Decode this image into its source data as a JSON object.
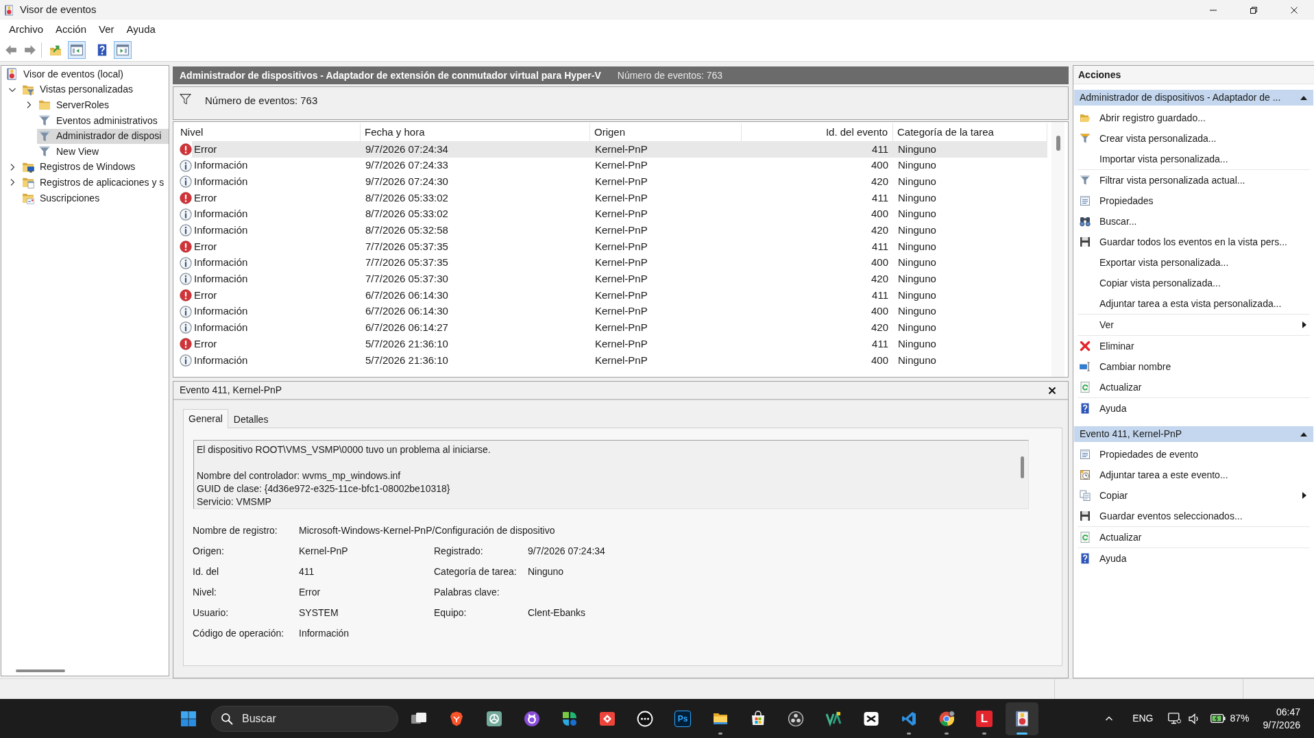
{
  "window": {
    "title": "Visor de eventos"
  },
  "menu": [
    "Archivo",
    "Acción",
    "Ver",
    "Ayuda"
  ],
  "toolbar": [
    [
      {
        "kind": "back",
        "on": false
      },
      {
        "kind": "forward",
        "on": false
      }
    ],
    [
      {
        "kind": "up-folder",
        "on": false
      },
      {
        "kind": "console-tree",
        "on": true
      },
      {
        "kind": "help",
        "on": false
      },
      {
        "kind": "action-pane",
        "on": true
      }
    ]
  ],
  "tree": [
    {
      "label": "Visor de eventos (local)",
      "kind": "event-viewer",
      "selected": false,
      "children": [
        {
          "label": "Vistas personalizadas",
          "kind": "filter-folder",
          "expanded": true,
          "selected": false,
          "children": [
            {
              "label": "ServerRoles",
              "kind": "folder",
              "expanded": false,
              "selected": false
            },
            {
              "label": "Eventos administrativos",
              "kind": "filter",
              "selected": false
            },
            {
              "label": "Administrador de disposi",
              "kind": "filter",
              "selected": true
            },
            {
              "label": "New View",
              "kind": "filter",
              "selected": false
            }
          ]
        },
        {
          "label": "Registros de Windows",
          "kind": "windows-folder",
          "expanded": false,
          "selected": false
        },
        {
          "label": "Registros de aplicaciones y s",
          "kind": "apps-folder",
          "expanded": false,
          "selected": false
        },
        {
          "label": "Suscripciones",
          "kind": "subscriptions-folder",
          "selected": false
        }
      ]
    }
  ],
  "event_list": {
    "title": "Administrador de dispositivos - Adaptador de extensión de conmutador virtual para Hyper-V",
    "count": "Número de eventos: 763",
    "filter_summary": "Número de eventos: 763",
    "columns": [
      "Nivel",
      "Fecha y hora",
      "Origen",
      "Id. del evento",
      "Categoría de la tarea"
    ],
    "rows": [
      {
        "kind": "error",
        "selected": true,
        "cells": [
          "Error",
          "9/7/2026 07:24:34",
          "Kernel-PnP",
          "411",
          "Ninguno"
        ]
      },
      {
        "kind": "info",
        "selected": false,
        "cells": [
          "Información",
          "9/7/2026 07:24:33",
          "Kernel-PnP",
          "400",
          "Ninguno"
        ]
      },
      {
        "kind": "info",
        "selected": false,
        "cells": [
          "Información",
          "9/7/2026 07:24:30",
          "Kernel-PnP",
          "420",
          "Ninguno"
        ]
      },
      {
        "kind": "error",
        "selected": false,
        "cells": [
          "Error",
          "8/7/2026 05:33:02",
          "Kernel-PnP",
          "411",
          "Ninguno"
        ]
      },
      {
        "kind": "info",
        "selected": false,
        "cells": [
          "Información",
          "8/7/2026 05:33:02",
          "Kernel-PnP",
          "400",
          "Ninguno"
        ]
      },
      {
        "kind": "info",
        "selected": false,
        "cells": [
          "Información",
          "8/7/2026 05:32:58",
          "Kernel-PnP",
          "420",
          "Ninguno"
        ]
      },
      {
        "kind": "error",
        "selected": false,
        "cells": [
          "Error",
          "7/7/2026 05:37:35",
          "Kernel-PnP",
          "411",
          "Ninguno"
        ]
      },
      {
        "kind": "info",
        "selected": false,
        "cells": [
          "Información",
          "7/7/2026 05:37:35",
          "Kernel-PnP",
          "400",
          "Ninguno"
        ]
      },
      {
        "kind": "info",
        "selected": false,
        "cells": [
          "Información",
          "7/7/2026 05:37:30",
          "Kernel-PnP",
          "420",
          "Ninguno"
        ]
      },
      {
        "kind": "error",
        "selected": false,
        "cells": [
          "Error",
          "6/7/2026 06:14:30",
          "Kernel-PnP",
          "411",
          "Ninguno"
        ]
      },
      {
        "kind": "info",
        "selected": false,
        "cells": [
          "Información",
          "6/7/2026 06:14:30",
          "Kernel-PnP",
          "400",
          "Ninguno"
        ]
      },
      {
        "kind": "info",
        "selected": false,
        "cells": [
          "Información",
          "6/7/2026 06:14:27",
          "Kernel-PnP",
          "420",
          "Ninguno"
        ]
      },
      {
        "kind": "error",
        "selected": false,
        "cells": [
          "Error",
          "5/7/2026 21:36:10",
          "Kernel-PnP",
          "411",
          "Ninguno"
        ]
      },
      {
        "kind": "info",
        "selected": false,
        "cells": [
          "Información",
          "5/7/2026 21:36:10",
          "Kernel-PnP",
          "400",
          "Ninguno"
        ]
      }
    ]
  },
  "event_detail": {
    "title": "Evento 411, Kernel-PnP",
    "tabs": [
      {
        "label": "General",
        "selected": true
      },
      {
        "label": "Detalles",
        "selected": false
      }
    ],
    "description": [
      [
        "El dispositivo ROOT\\VMS_VSMP\\0000 tuvo un problema al iniciarse."
      ],
      [
        "Nombre del controlador: wvms_mp_windows.inf",
        "GUID de clase: {4d36e972-e325-11ce-bfc1-08002be10318}",
        "Servicio: VMSMP"
      ]
    ],
    "fields": [
      [
        {
          "label": "Nombre de registro:",
          "value": "Microsoft-Windows-Kernel-PnP/Configuración de dispositivo"
        }
      ],
      [
        {
          "label": "Origen:",
          "value": "Kernel-PnP"
        },
        {
          "label": "Registrado:",
          "value": "9/7/2026 07:24:34"
        }
      ],
      [
        {
          "label": "Id. del",
          "value": "411"
        },
        {
          "label": "Categoría de tarea:",
          "value": "Ninguno"
        }
      ],
      [
        {
          "label": "Nivel:",
          "value": "Error"
        },
        {
          "label": "Palabras clave:"
        }
      ],
      [
        {
          "label": "Usuario:",
          "value": "SYSTEM"
        },
        {
          "label": "Equipo:",
          "value": "Clent-Ebanks"
        }
      ],
      [
        {
          "label": "Código de operación:",
          "value": "Información"
        }
      ]
    ]
  },
  "actions": {
    "title": "Acciones",
    "sections": [
      {
        "title": "Administrador de dispositivos - Adaptador de ...",
        "expanded": true,
        "groups": [
          [
            {
              "label": "Abrir registro guardado...",
              "kind": "open-folder",
              "submenu": false
            },
            {
              "label": "Crear vista personalizada...",
              "kind": "new-filter",
              "submenu": false
            },
            {
              "label": "Importar vista personalizada...",
              "kind": "plain",
              "submenu": false
            }
          ],
          [
            {
              "label": "Filtrar vista personalizada actual...",
              "kind": "filter",
              "submenu": false
            },
            {
              "label": "Propiedades",
              "kind": "properties",
              "submenu": false
            },
            {
              "label": "Buscar...",
              "kind": "binoculars",
              "submenu": false
            },
            {
              "label": "Guardar todos los eventos en la vista pers...",
              "kind": "save",
              "submenu": false
            },
            {
              "label": "Exportar vista personalizada...",
              "kind": "plain",
              "submenu": false
            },
            {
              "label": "Copiar vista personalizada...",
              "kind": "plain",
              "submenu": false
            },
            {
              "label": "Adjuntar tarea a esta vista personalizada...",
              "kind": "plain",
              "submenu": false
            }
          ],
          [
            {
              "label": "Ver",
              "kind": "plain",
              "submenu": true
            }
          ],
          [
            {
              "label": "Eliminar",
              "kind": "delete",
              "submenu": false
            },
            {
              "label": "Cambiar nombre",
              "kind": "rename",
              "submenu": false
            },
            {
              "label": "Actualizar",
              "kind": "refresh",
              "submenu": false
            }
          ],
          [
            {
              "label": "Ayuda",
              "kind": "help",
              "submenu": false
            }
          ]
        ]
      },
      {
        "title": "Evento 411, Kernel-PnP",
        "expanded": true,
        "groups": [
          [
            {
              "label": "Propiedades de evento",
              "kind": "properties",
              "submenu": false
            },
            {
              "label": "Adjuntar tarea a este evento...",
              "kind": "task",
              "submenu": false
            },
            {
              "label": "Copiar",
              "kind": "copy",
              "submenu": true
            },
            {
              "label": "Guardar eventos seleccionados...",
              "kind": "save",
              "submenu": false
            }
          ],
          [
            {
              "label": "Actualizar",
              "kind": "refresh",
              "submenu": false
            }
          ],
          [
            {
              "label": "Ayuda",
              "kind": "help",
              "submenu": false
            }
          ]
        ]
      }
    ]
  },
  "taskbar": {
    "search": {
      "placeholder": "Buscar"
    },
    "apps": [
      {
        "kind": "overlap-windows",
        "running": false,
        "active": false
      },
      {
        "kind": "lion-shield",
        "running": false,
        "active": false
      },
      {
        "kind": "knot-tile",
        "running": false,
        "active": false
      },
      {
        "kind": "cat-badge",
        "running": false,
        "active": false
      },
      {
        "kind": "leaf-tiles",
        "running": false,
        "active": false
      },
      {
        "kind": "diamond-tile",
        "running": false,
        "active": false
      },
      {
        "kind": "dots-ring",
        "running": false,
        "active": false
      },
      {
        "kind": "ps-tile",
        "glyph": "Ps",
        "running": false,
        "active": false
      },
      {
        "kind": "folder",
        "running": true,
        "active": false
      },
      {
        "kind": "shopping-bag",
        "running": false,
        "active": false
      },
      {
        "kind": "three-dot-ring",
        "running": false,
        "active": false
      },
      {
        "kind": "double-v",
        "running": false,
        "active": false
      },
      {
        "kind": "bowtie-tile",
        "running": false,
        "active": false
      },
      {
        "kind": "code-ribbon",
        "running": true,
        "active": false
      },
      {
        "kind": "color-wheel",
        "running": true,
        "active": false
      },
      {
        "kind": "red-letter-tile",
        "glyph": "L",
        "running": true,
        "active": false
      },
      {
        "kind": "log-book",
        "running": true,
        "active": true
      }
    ],
    "tray": {
      "language": "ENG",
      "battery": "87%",
      "time": "06:47",
      "date": "9/7/2026"
    }
  }
}
